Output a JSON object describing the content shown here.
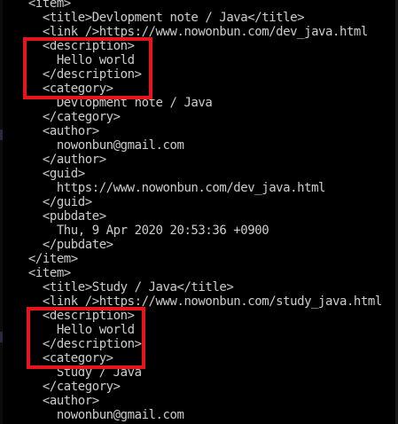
{
  "console": {
    "lines": [
      "    <item>",
      "      <title>Devlopment note / Java</title>",
      "      <link />https://www.nowonbun.com/dev_java.html",
      "      <description>",
      "        Hello world",
      "      </description>",
      "      <category>",
      "        Devlopment note / Java",
      "      </category>",
      "      <author>",
      "        nowonbun@gmail.com",
      "      </author>",
      "      <guid>",
      "        https://www.nowonbun.com/dev_java.html",
      "      </guid>",
      "      <pubdate>",
      "        Thu, 9 Apr 2020 20:53:36 +0900",
      "      </pubdate>",
      "    </item>",
      "    <item>",
      "      <title>Study / Java</title>",
      "      <link />https://www.nowonbun.com/study_java.html",
      "      <description>",
      "        Hello world",
      "      </description>",
      "      <category>",
      "        Study / Java",
      "      </category>",
      "      <author>",
      "        nowonbun@gmail.com"
    ]
  },
  "colors": {
    "background": "#000000",
    "text": "#cccccc",
    "highlight": "#e8141c"
  }
}
